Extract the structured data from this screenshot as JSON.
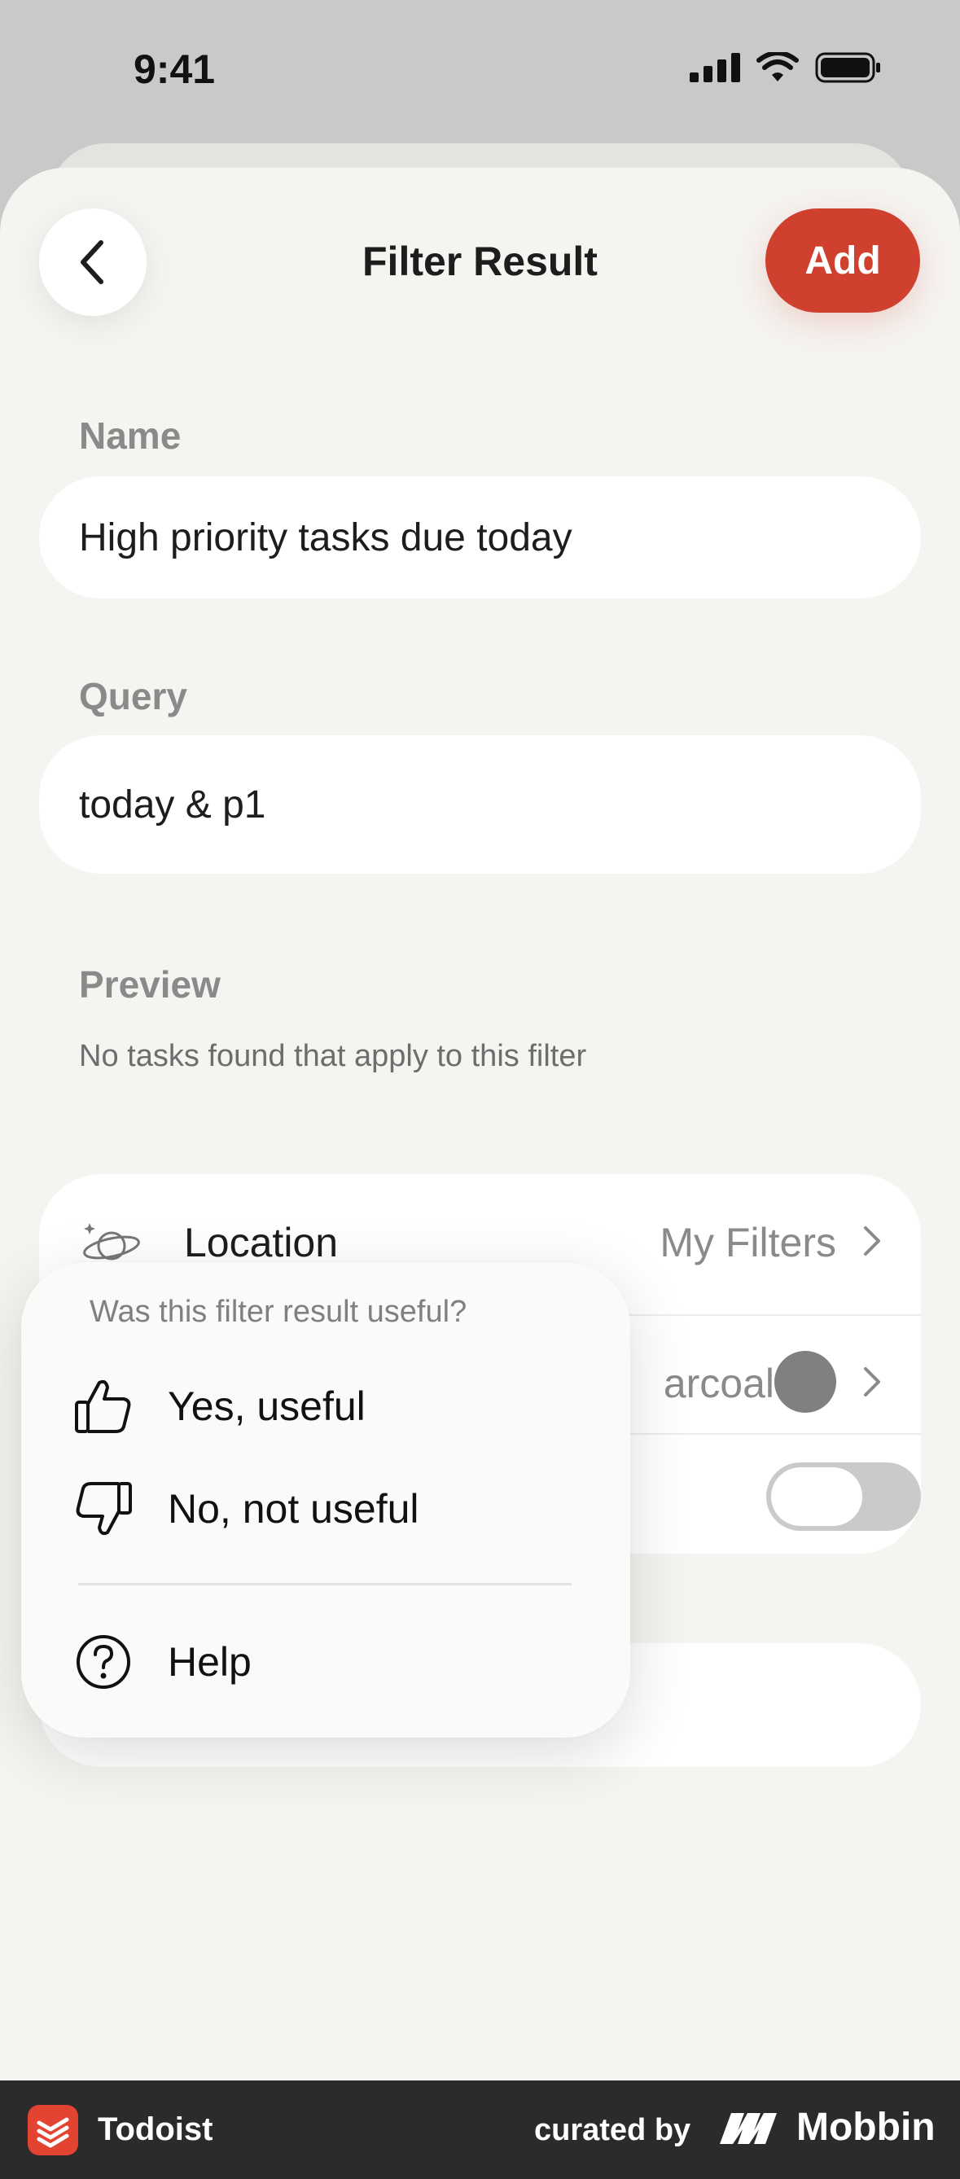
{
  "status_bar": {
    "time": "9:41"
  },
  "header": {
    "title": "Filter Result",
    "add_label": "Add"
  },
  "form": {
    "name_label": "Name",
    "name_value": "High priority tasks due today",
    "query_label": "Query",
    "query_value": "today & p1",
    "preview_label": "Preview",
    "preview_text": "No tasks found that apply to this filter"
  },
  "settings": {
    "location_label": "Location",
    "location_value": "My Filters",
    "color_value_partial": "arcoal",
    "color_swatch": "#808080",
    "favorite_toggle_on": false
  },
  "popover": {
    "question": "Was this filter result useful?",
    "items": [
      {
        "label": "Yes, useful",
        "icon": "thumbs-up-icon"
      },
      {
        "label": "No, not useful",
        "icon": "thumbs-down-icon"
      },
      {
        "label": "Help",
        "icon": "help-circle-icon"
      }
    ]
  },
  "brand_bar": {
    "app_name": "Todoist",
    "curated_by": "curated by",
    "mobbin": "Mobbin"
  },
  "colors": {
    "accent": "#d0402f",
    "background": "#f5f4f1"
  }
}
